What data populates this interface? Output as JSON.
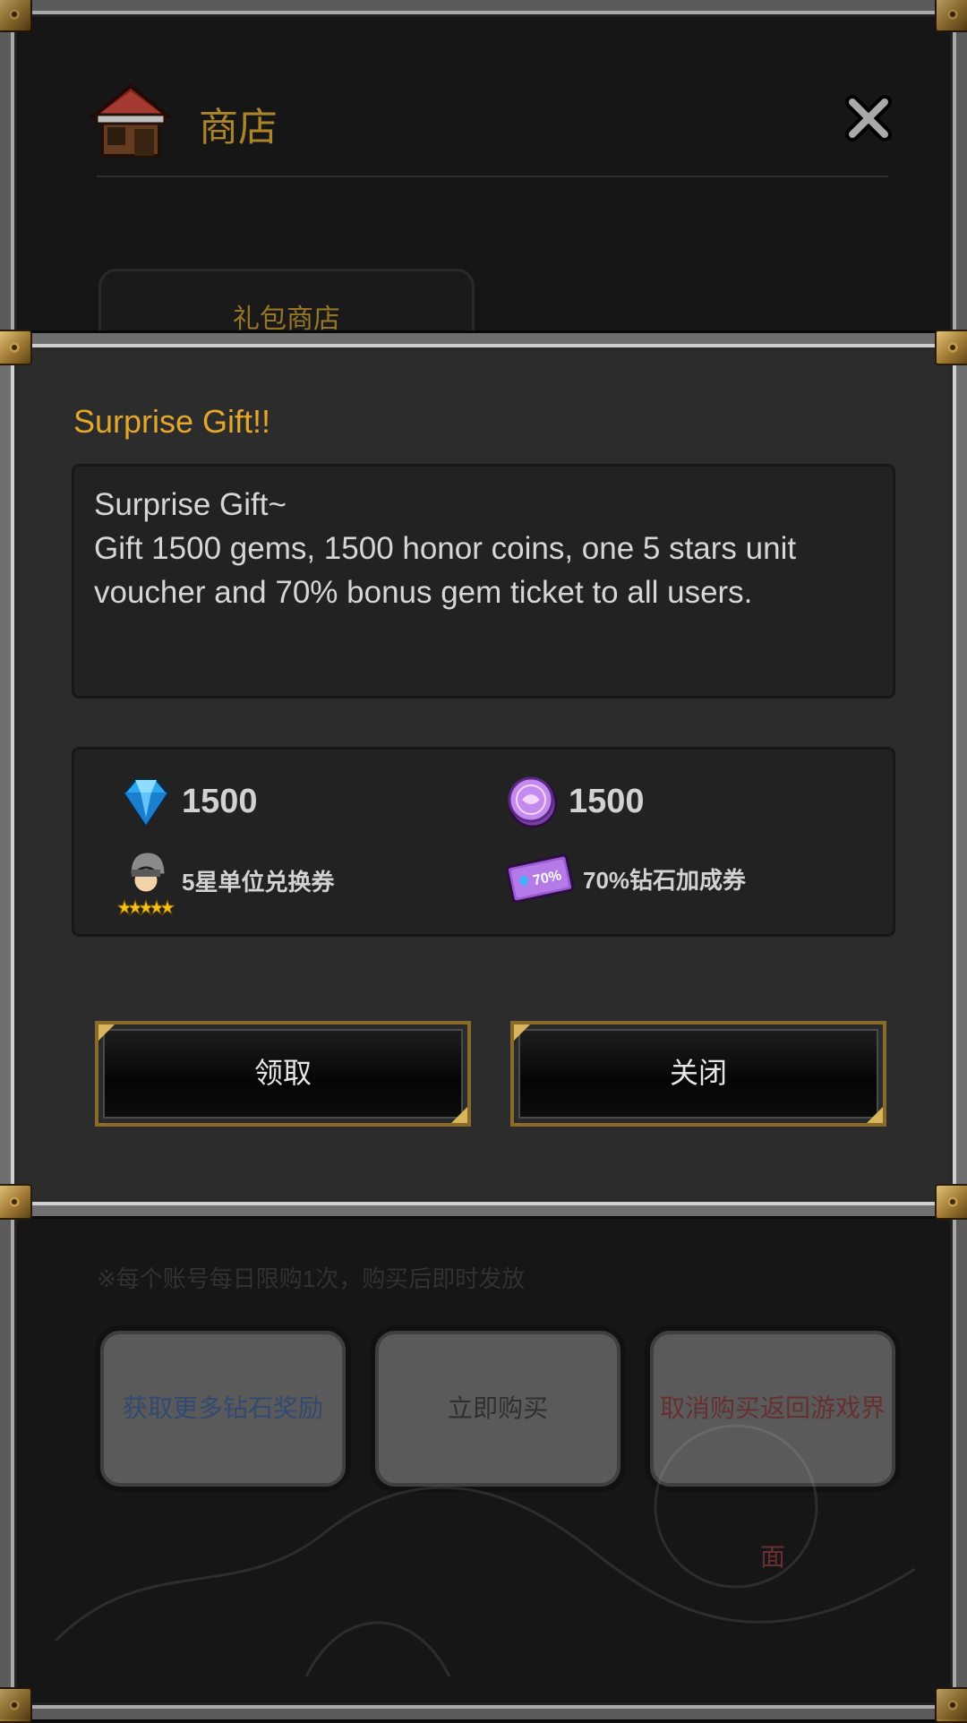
{
  "background": {
    "title": "商店",
    "tab_label": "礼包商店",
    "note": "※每个账号每日限购1次，购买后即时发放",
    "buttons": [
      "获取更多钻石奖励",
      "立即购买",
      "取消购买返回游戏界面"
    ]
  },
  "dialog": {
    "title": "Surprise Gift!!",
    "message_lines": [
      "Surprise Gift~",
      "Gift 1500 gems, 1500 honor coins, one 5 stars unit",
      "voucher and 70% bonus gem ticket to all users."
    ],
    "rewards": [
      {
        "icon": "gem-icon",
        "text": "1500"
      },
      {
        "icon": "honor-coin-icon",
        "text": "1500"
      },
      {
        "icon": "unit-voucher-icon",
        "text": "5星单位兑换券"
      },
      {
        "icon": "bonus-ticket-icon",
        "text": "70%钻石加成券"
      }
    ],
    "buttons": {
      "left": "领取",
      "right": "关闭"
    }
  },
  "colors": {
    "accent": "#e3a72b",
    "frame": "#6f6f6f",
    "corner": "#c59a4a"
  }
}
